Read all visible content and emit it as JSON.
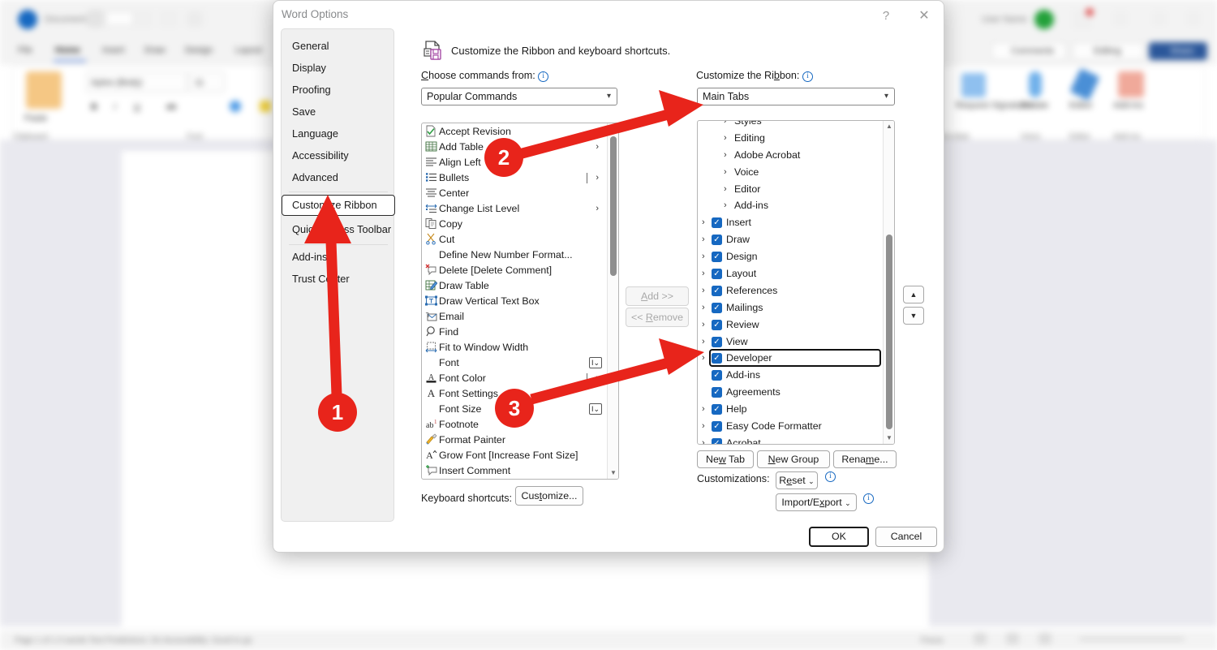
{
  "background_app": {
    "name": "Microsoft Word",
    "tabs": [
      "File",
      "Home",
      "Insert",
      "Draw",
      "Design",
      "Layout"
    ],
    "active_tab": "Home",
    "font_name": "Aptos (Body)",
    "font_size": "11",
    "group_labels": [
      "Clipboard",
      "Font"
    ],
    "right_buttons": [
      "Comments",
      "Editing",
      "Share"
    ],
    "right_ribbon_items": [
      "Request Signatures",
      "Dictate",
      "Editor",
      "Add-ins"
    ],
    "right_ribbon_groups": [
      "Acrobat",
      "Voice",
      "Editor",
      "Add-ins"
    ],
    "status_bar": "Page 1 of 1    0 words    Text Predictions: On    Accessibility: Good to go",
    "paste_label": "Paste"
  },
  "dialog": {
    "title": "Word Options",
    "help_icon": "question-mark-icon",
    "close_icon": "close-icon",
    "header_icon": "customize-ribbon-icon",
    "header_text": "Customize the Ribbon and keyboard shortcuts.",
    "nav_items": [
      {
        "label": "General",
        "selected": false
      },
      {
        "label": "Display",
        "selected": false
      },
      {
        "label": "Proofing",
        "selected": false
      },
      {
        "label": "Save",
        "selected": false
      },
      {
        "label": "Language",
        "selected": false
      },
      {
        "label": "Accessibility",
        "selected": false
      },
      {
        "label": "Advanced",
        "selected": false
      },
      {
        "label": "Customize Ribbon",
        "selected": true
      },
      {
        "label": "Quick Access Toolbar",
        "selected": false
      },
      {
        "label": "Add-ins",
        "selected": false
      },
      {
        "label": "Trust Center",
        "selected": false
      }
    ],
    "choose_commands_label": "Choose commands from:",
    "choose_commands_value": "Popular Commands",
    "customize_ribbon_label": "Customize the Ribbon:",
    "customize_ribbon_value": "Main Tabs",
    "commands": [
      {
        "label": "Accept Revision",
        "icon": "accept-revision-icon",
        "chevron": false
      },
      {
        "label": "Add Table",
        "icon": "table-icon",
        "chevron": true
      },
      {
        "label": "Align Left",
        "icon": "align-left-icon",
        "chevron": false
      },
      {
        "label": "Bullets",
        "icon": "bullets-icon",
        "chevron": true,
        "split": true
      },
      {
        "label": "Center",
        "icon": "align-center-icon",
        "chevron": false
      },
      {
        "label": "Change List Level",
        "icon": "change-list-level-icon",
        "chevron": true
      },
      {
        "label": "Copy",
        "icon": "copy-icon",
        "chevron": false
      },
      {
        "label": "Cut",
        "icon": "scissors-icon",
        "chevron": false
      },
      {
        "label": "Define New Number Format...",
        "icon": "none",
        "chevron": false
      },
      {
        "label": "Delete [Delete Comment]",
        "icon": "delete-comment-icon",
        "chevron": false
      },
      {
        "label": "Draw Table",
        "icon": "draw-table-icon",
        "chevron": false
      },
      {
        "label": "Draw Vertical Text Box",
        "icon": "vertical-text-box-icon",
        "chevron": false
      },
      {
        "label": "Email",
        "icon": "email-icon",
        "chevron": false
      },
      {
        "label": "Find",
        "icon": "magnifier-icon",
        "chevron": false
      },
      {
        "label": "Fit to Window Width",
        "icon": "fit-width-icon",
        "chevron": false
      },
      {
        "label": "Font",
        "icon": "none",
        "chevron": false,
        "dropbox": true
      },
      {
        "label": "Font Color",
        "icon": "font-color-icon",
        "chevron": true
      },
      {
        "label": "Font Settings",
        "icon": "font-settings-icon",
        "chevron": false
      },
      {
        "label": "Font Size",
        "icon": "none",
        "chevron": false,
        "dropbox": true
      },
      {
        "label": "Footnote",
        "icon": "footnote-icon",
        "chevron": false
      },
      {
        "label": "Format Painter",
        "icon": "format-painter-icon",
        "chevron": false
      },
      {
        "label": "Grow Font [Increase Font Size]",
        "icon": "grow-font-icon",
        "chevron": false
      },
      {
        "label": "Insert Comment",
        "icon": "insert-comment-icon",
        "chevron": false
      }
    ],
    "add_button": "Add >>",
    "remove_button": "<< Remove",
    "ribbon_tree": [
      {
        "label": "Styles",
        "indent": 2,
        "chevron": true,
        "checkbox": false,
        "partial": true
      },
      {
        "label": "Editing",
        "indent": 2,
        "chevron": true,
        "checkbox": false
      },
      {
        "label": "Adobe Acrobat",
        "indent": 2,
        "chevron": true,
        "checkbox": false
      },
      {
        "label": "Voice",
        "indent": 2,
        "chevron": true,
        "checkbox": false
      },
      {
        "label": "Editor",
        "indent": 2,
        "chevron": true,
        "checkbox": false
      },
      {
        "label": "Add-ins",
        "indent": 2,
        "chevron": true,
        "checkbox": false
      },
      {
        "label": "Insert",
        "indent": 1,
        "chevron": true,
        "checkbox": true,
        "checked": true
      },
      {
        "label": "Draw",
        "indent": 1,
        "chevron": true,
        "checkbox": true,
        "checked": true
      },
      {
        "label": "Design",
        "indent": 1,
        "chevron": true,
        "checkbox": true,
        "checked": true
      },
      {
        "label": "Layout",
        "indent": 1,
        "chevron": true,
        "checkbox": true,
        "checked": true
      },
      {
        "label": "References",
        "indent": 1,
        "chevron": true,
        "checkbox": true,
        "checked": true
      },
      {
        "label": "Mailings",
        "indent": 1,
        "chevron": true,
        "checkbox": true,
        "checked": true
      },
      {
        "label": "Review",
        "indent": 1,
        "chevron": true,
        "checkbox": true,
        "checked": true
      },
      {
        "label": "View",
        "indent": 1,
        "chevron": true,
        "checkbox": true,
        "checked": true
      },
      {
        "label": "Developer",
        "indent": 1,
        "chevron": true,
        "checkbox": true,
        "checked": true,
        "highlighted": true
      },
      {
        "label": "Add-ins",
        "indent": 1,
        "chevron": false,
        "checkbox": true,
        "checked": true
      },
      {
        "label": "Agreements",
        "indent": 1,
        "chevron": false,
        "checkbox": true,
        "checked": true
      },
      {
        "label": "Help",
        "indent": 1,
        "chevron": true,
        "checkbox": true,
        "checked": true
      },
      {
        "label": "Easy Code Formatter",
        "indent": 1,
        "chevron": true,
        "checkbox": true,
        "checked": true
      },
      {
        "label": "Acrobat",
        "indent": 1,
        "chevron": true,
        "checkbox": true,
        "checked": true
      }
    ],
    "move_up_icon": "triangle-up-icon",
    "move_down_icon": "triangle-down-icon",
    "new_tab_button": "New Tab",
    "new_group_button": "New Group",
    "rename_button": "Rename...",
    "customizations_label": "Customizations:",
    "reset_button": "Reset",
    "import_export_button": "Import/Export",
    "keyboard_shortcuts_label": "Keyboard shortcuts:",
    "customize_button": "Customize...",
    "ok_button": "OK",
    "cancel_button": "Cancel"
  },
  "annotations": {
    "accent_color": "#e8241b",
    "markers": [
      {
        "number": "1",
        "target": "Customize Ribbon nav item"
      },
      {
        "number": "2",
        "target": "Customize the Ribbon dropdown (Main Tabs)"
      },
      {
        "number": "3",
        "target": "Developer checkbox in Main Tabs list"
      }
    ]
  }
}
